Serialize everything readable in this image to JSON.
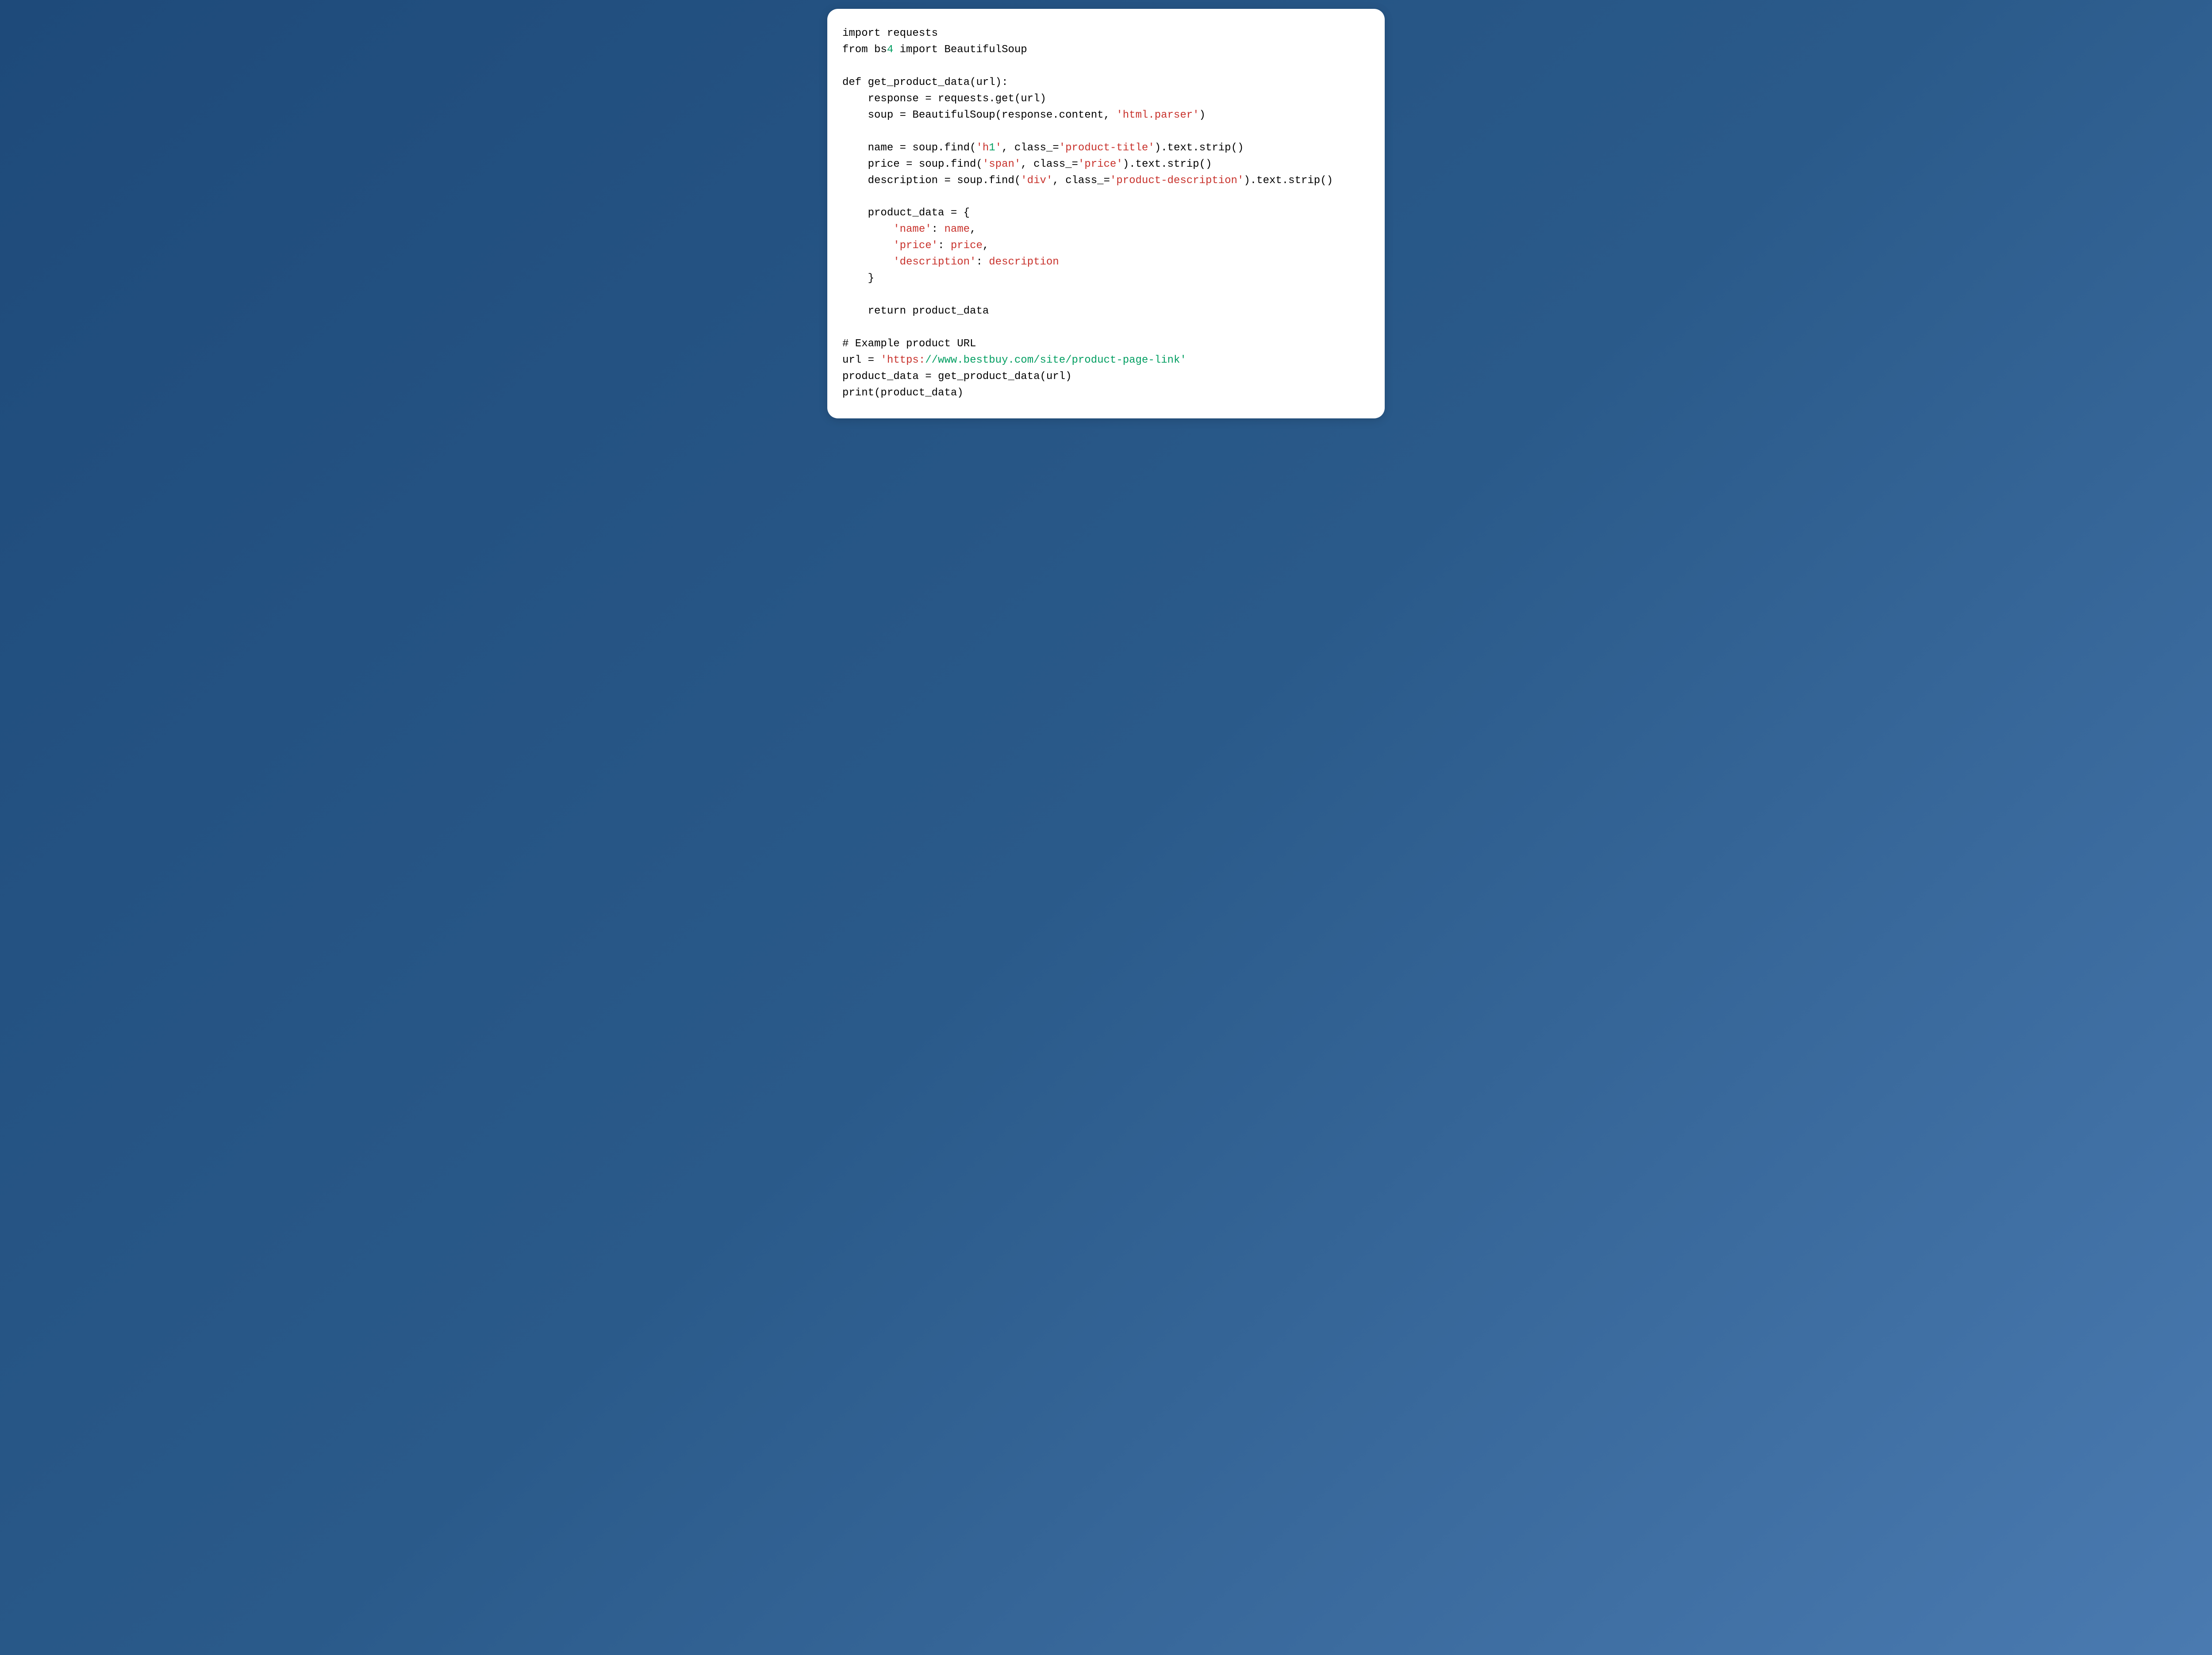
{
  "code": {
    "line1_a": "import",
    "line1_b": " requests",
    "line2_a": "from",
    "line2_b": " bs",
    "line2_num": "4",
    "line2_c": " ",
    "line2_d": "import",
    "line2_e": " BeautifulSoup",
    "line3": "",
    "line4_a": "def",
    "line4_b": " get_product_data(url):",
    "line5": "    response = requests.get(url)",
    "line6_a": "    soup = BeautifulSoup(response.content, ",
    "line6_str": "'html.parser'",
    "line6_b": ")",
    "line7": "",
    "line8_a": "    name = soup.find(",
    "line8_str1a": "'h",
    "line8_str1num": "1",
    "line8_str1b": "'",
    "line8_b": ", class_=",
    "line8_str2": "'product-title'",
    "line8_c": ").text.strip()",
    "line9_a": "    price = soup.find(",
    "line9_str1": "'span'",
    "line9_b": ", class_=",
    "line9_str2": "'price'",
    "line9_c": ").text.strip()",
    "line10_a": "    description = soup.find(",
    "line10_str1": "'div'",
    "line10_b": ", class_=",
    "line10_str2": "'product-description'",
    "line10_c": ").text.strip()",
    "line11": "",
    "line12": "    product_data = {",
    "line13_a": "        ",
    "line13_key": "'name'",
    "line13_b": ": ",
    "line13_val": "name",
    "line13_c": ",",
    "line14_a": "        ",
    "line14_key": "'price'",
    "line14_b": ": ",
    "line14_val": "price",
    "line14_c": ",",
    "line15_a": "        ",
    "line15_key": "'description'",
    "line15_b": ": ",
    "line15_val": "description",
    "line16": "    }",
    "line17": "",
    "line18_a": "    ",
    "line18_b": "return",
    "line18_c": " product_data",
    "line19": "",
    "line20": "# Example product URL",
    "line21_a": "url = ",
    "line21_str_a": "'https:",
    "line21_str_b": "//www.bestbuy.com/site/product-page-link'",
    "line22": "product_data = get_product_data(url)",
    "line23": "print(product_data)"
  }
}
